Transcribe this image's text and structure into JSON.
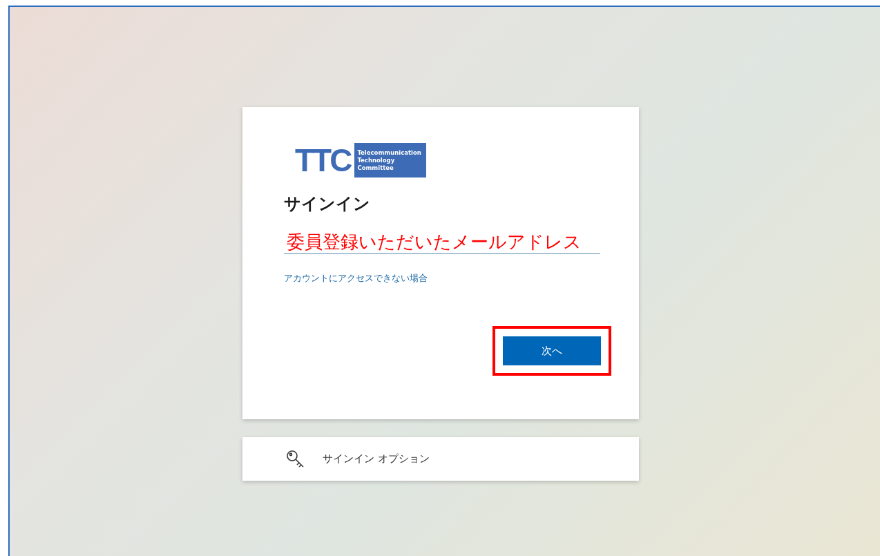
{
  "logo": {
    "mark": "TTC",
    "lines": [
      "Telecommunication",
      "Technology",
      "Committee"
    ]
  },
  "title": "サインイン",
  "email_field": {
    "value": "委員登録いただいたメールアドレス"
  },
  "help_link": "アカウントにアクセスできない場合",
  "next_button": {
    "label": "次へ",
    "highlighted": true
  },
  "options": {
    "label": "サインイン オプション"
  }
}
